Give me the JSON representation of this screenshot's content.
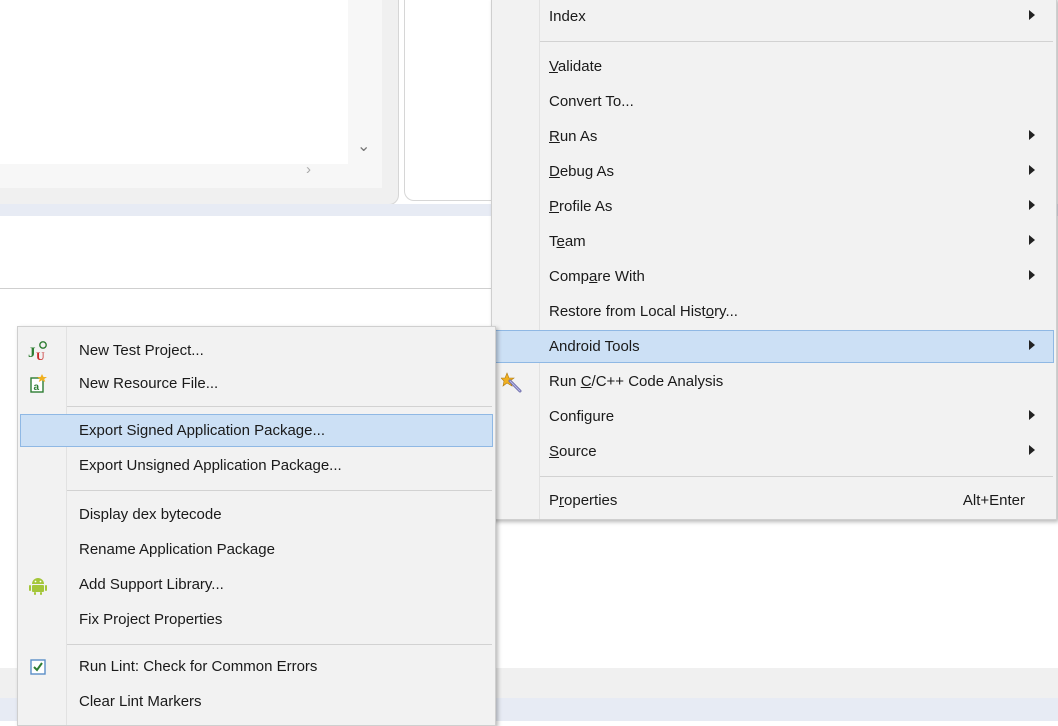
{
  "context_menu": {
    "items": [
      {
        "id": "index",
        "label": "Index",
        "mnemonic_index": -1,
        "has_submenu": true
      },
      {
        "id": "validate",
        "label": "Validate",
        "mnemonic_index": 0
      },
      {
        "id": "convert",
        "label": "Convert To...",
        "mnemonic_index": -1
      },
      {
        "id": "run-as",
        "label": "Run As",
        "mnemonic_index": 0,
        "has_submenu": true
      },
      {
        "id": "debug-as",
        "label": "Debug As",
        "mnemonic_index": 0,
        "has_submenu": true
      },
      {
        "id": "profile-as",
        "label": "Profile As",
        "mnemonic_index": 0,
        "has_submenu": true
      },
      {
        "id": "team",
        "label": "Team",
        "mnemonic_index": 1,
        "has_submenu": true
      },
      {
        "id": "compare",
        "label": "Compare With",
        "mnemonic_index": 4,
        "has_submenu": true
      },
      {
        "id": "restore",
        "label": "Restore from Local History...",
        "mnemonic_index": 23
      },
      {
        "id": "android-tools",
        "label": "Android Tools",
        "mnemonic_index": -1,
        "has_submenu": true,
        "highlighted": true
      },
      {
        "id": "run-cpp",
        "label": "Run C/C++ Code Analysis",
        "mnemonic_index": 4,
        "icon": "code-analysis-icon"
      },
      {
        "id": "configure",
        "label": "Configure",
        "mnemonic_index": 5,
        "has_submenu": true
      },
      {
        "id": "source",
        "label": "Source",
        "mnemonic_index": 0,
        "has_submenu": true
      },
      {
        "id": "properties",
        "label": "Properties",
        "mnemonic_index": 1,
        "shortcut": "Alt+Enter"
      }
    ]
  },
  "android_tools_submenu": {
    "items": [
      {
        "id": "new-test-project",
        "label": "New Test Project...",
        "icon": "junit-icon"
      },
      {
        "id": "new-resource-file",
        "label": "New Resource File...",
        "icon": "new-file-icon"
      },
      {
        "id": "export-signed",
        "label": "Export Signed Application Package...",
        "highlighted": true
      },
      {
        "id": "export-unsigned",
        "label": "Export Unsigned Application Package..."
      },
      {
        "id": "display-dex",
        "label": "Display dex bytecode"
      },
      {
        "id": "rename-package",
        "label": "Rename Application Package"
      },
      {
        "id": "add-support-lib",
        "label": "Add Support Library...",
        "icon": "android-icon"
      },
      {
        "id": "fix-properties",
        "label": "Fix Project Properties"
      },
      {
        "id": "run-lint",
        "label": "Run Lint: Check for Common Errors",
        "icon": "lint-check-icon"
      },
      {
        "id": "clear-lint",
        "label": "Clear Lint Markers"
      }
    ]
  },
  "colors": {
    "menu_bg": "#f2f2f2",
    "highlight_bg": "#cce0f5",
    "highlight_border": "#8fb8e4",
    "android_green": "#a4c639"
  }
}
